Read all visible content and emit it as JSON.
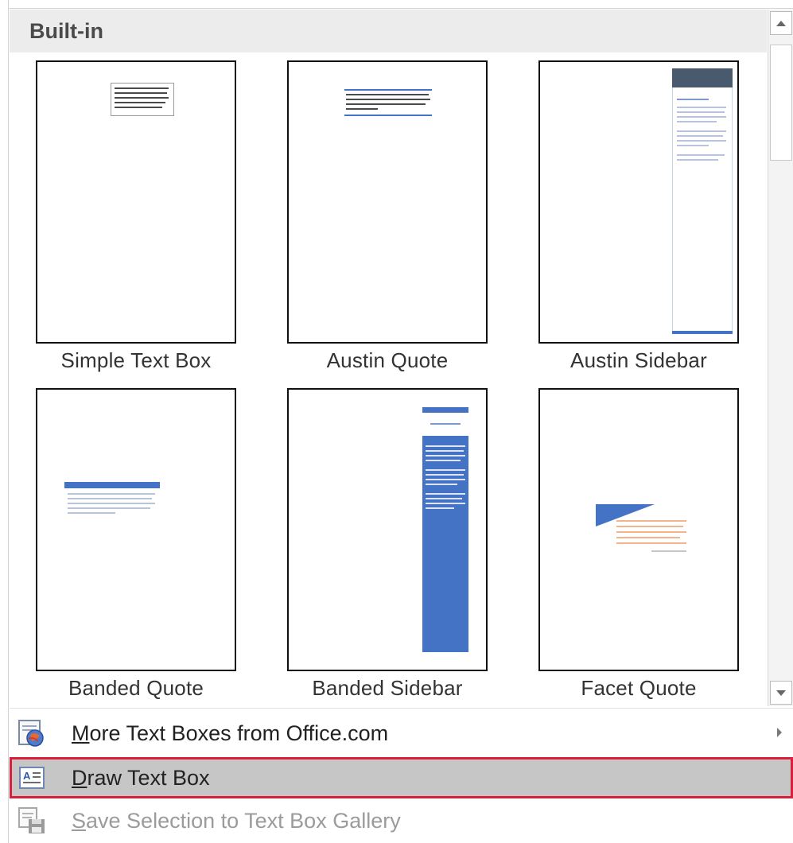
{
  "gallery": {
    "header": "Built-in",
    "items": [
      {
        "label": "Simple Text Box"
      },
      {
        "label": "Austin Quote"
      },
      {
        "label": "Austin Sidebar"
      },
      {
        "label": "Banded Quote"
      },
      {
        "label": "Banded Sidebar"
      },
      {
        "label": "Facet Quote"
      }
    ]
  },
  "menu": {
    "more": {
      "label_first": "M",
      "label_rest": "ore Text Boxes from Office.com",
      "icon": "globe-document-icon"
    },
    "draw": {
      "label_first": "D",
      "label_rest": "raw Text Box",
      "icon": "text-box-icon"
    },
    "save": {
      "label_first": "S",
      "label_rest": "ave Selection to Text Box Gallery",
      "icon": "save-to-gallery-icon"
    }
  },
  "colors": {
    "accent_blue": "#4472c4",
    "highlight_border": "#d9203a",
    "header_bg": "#ececec"
  }
}
